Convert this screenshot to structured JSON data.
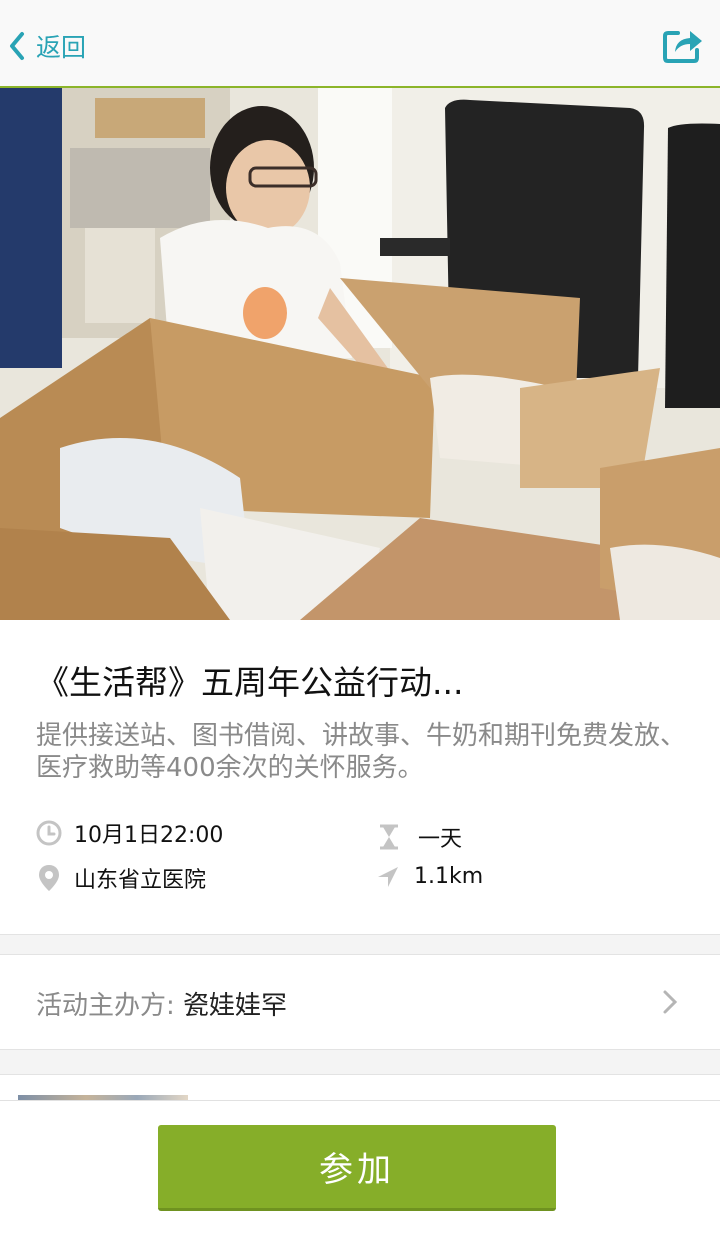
{
  "header": {
    "back_label": "返回",
    "share_icon": "share-icon"
  },
  "event": {
    "title": "《生活帮》五周年公益行动...",
    "description": "提供接送站、图书借阅、讲故事、牛奶和期刊免费发放、医疗救助等400余次的关怀服务。",
    "time": "10月1日22:00",
    "duration": "一天",
    "location": "山东省立医院",
    "distance": "1.1km"
  },
  "organizer": {
    "label": "活动主办方: ",
    "name": "瓷娃娃罕"
  },
  "actions": {
    "join_label": "参加"
  },
  "colors": {
    "accent_teal": "#29a3b5",
    "button_green": "#86ae29",
    "divider_green": "#8cb52a",
    "muted_text": "#8a8a8a"
  }
}
